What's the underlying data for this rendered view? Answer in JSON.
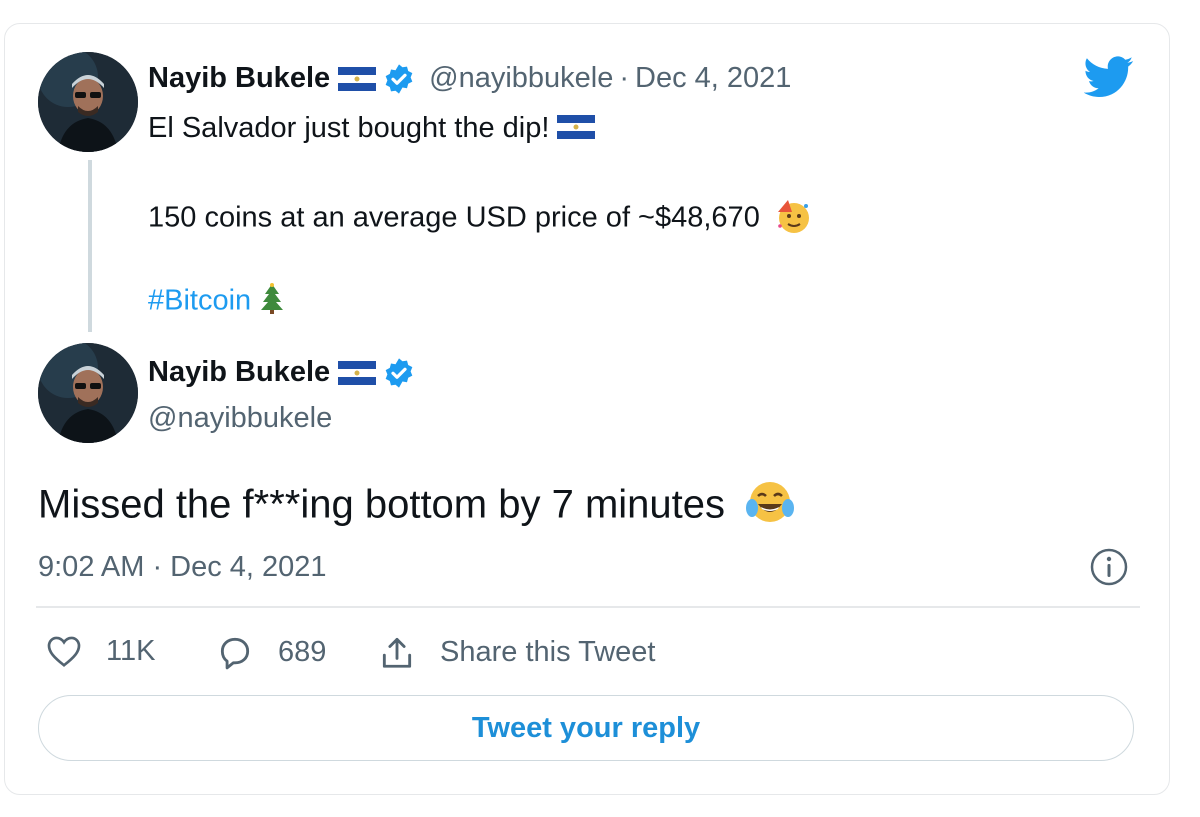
{
  "brand": {
    "icon": "twitter-bird-icon",
    "color": "#1d9bf0"
  },
  "quoted_tweet": {
    "author_name": "Nayib Bukele",
    "handle": "@nayibbukele",
    "separator": "·",
    "date": "Dec 4, 2021",
    "line1": "El Salvador just bought the dip!",
    "line2": "150 coins at an average USD price of ~$48,670",
    "hashtag": "#Bitcoin"
  },
  "main_tweet": {
    "author_name": "Nayib Bukele",
    "handle": "@nayibbukele",
    "text": "Missed the f***ing bottom by 7 minutes",
    "timestamp": "9:02 AM · Dec 4, 2021"
  },
  "actions": {
    "likes": "11K",
    "replies": "689",
    "share_label": "Share this Tweet"
  },
  "reply_prompt": "Tweet your reply",
  "colors": {
    "accent": "#1d9bf0",
    "text_primary": "#0f1419",
    "text_secondary": "#536471",
    "border": "#e6e8ea"
  }
}
